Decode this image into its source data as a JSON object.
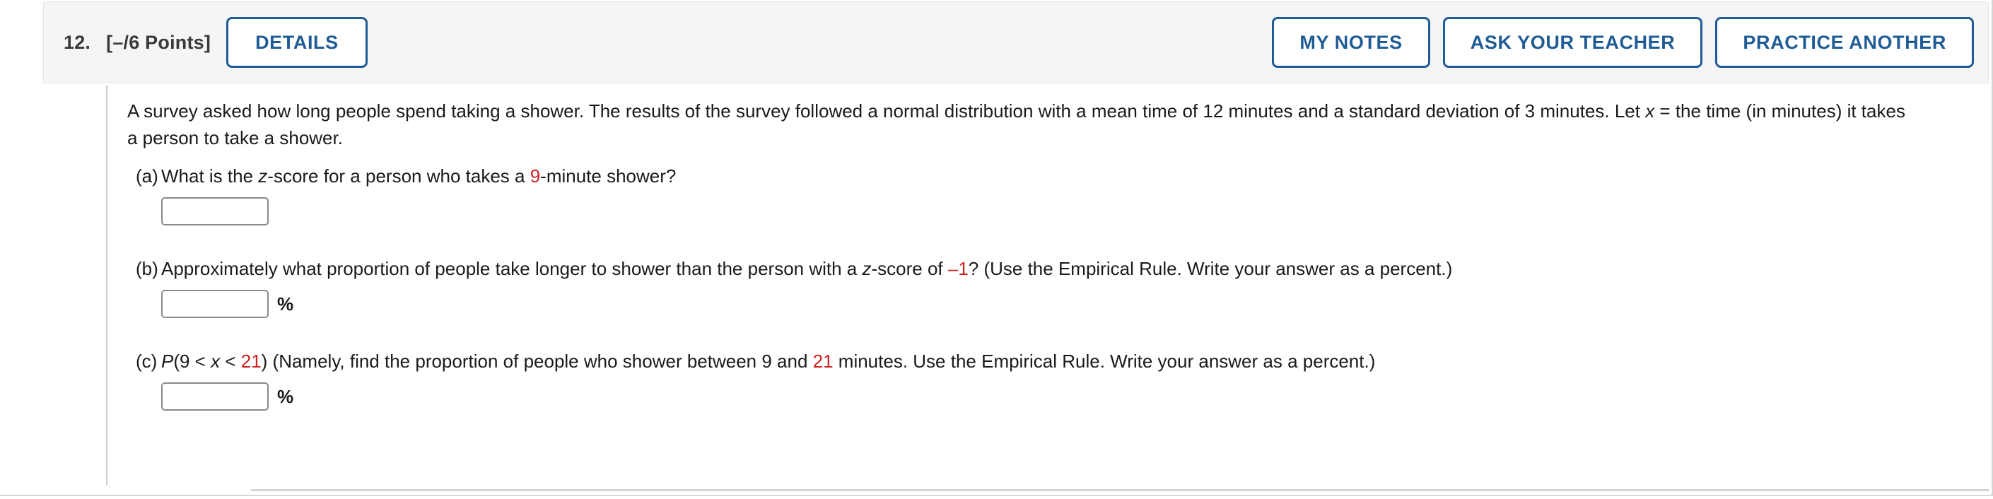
{
  "header": {
    "question_number": "12.",
    "points": "[–/6 Points]",
    "details_label": "DETAILS",
    "my_notes_label": "MY NOTES",
    "ask_your_teacher_label": "ASK YOUR TEACHER",
    "practice_another_label": "PRACTICE ANOTHER"
  },
  "colors": {
    "accent_blue": "#1f5c96",
    "highlight_red": "#cc2222",
    "header_bg": "#f5f5f5",
    "input_border": "#8a8a8a"
  },
  "stem": {
    "line1_a": "A survey asked how long people spend taking a shower. The results of the survey followed a normal distribution with a mean time of 12 minutes and a standard deviation of 3 minutes. Let ",
    "line2_var": "x",
    "line2_rest": " = the time (in minutes) it takes a person to take a shower."
  },
  "parts": [
    {
      "label": "(a)",
      "text_1": "What is the ",
      "italic_1": "z",
      "text_2": "-score for a person who takes a ",
      "red_1": "9",
      "text_3": "-minute shower?",
      "input_value": "",
      "input_placeholder": "",
      "unit": ""
    },
    {
      "label": "(b)",
      "text_1": "Approximately what proportion of people take longer to shower than the person with a ",
      "italic_1": "z",
      "text_2": "-score of ",
      "red_1": "–1",
      "text_3": "? (Use the Empirical Rule. Write your answer as a percent.)",
      "input_value": "",
      "input_placeholder": "",
      "unit": "%"
    },
    {
      "label": "(c)",
      "text_1": "P",
      "text_2": "(9 < ",
      "italic_1": "x",
      "text_3": " < ",
      "red_1": "21",
      "text_4": ") (Namely, find the proportion of people who shower between 9 and ",
      "red_2": "21",
      "text_5": " minutes. Use the Empirical Rule. Write your answer as a percent.)",
      "input_value": "",
      "input_placeholder": "",
      "unit": "%"
    }
  ]
}
